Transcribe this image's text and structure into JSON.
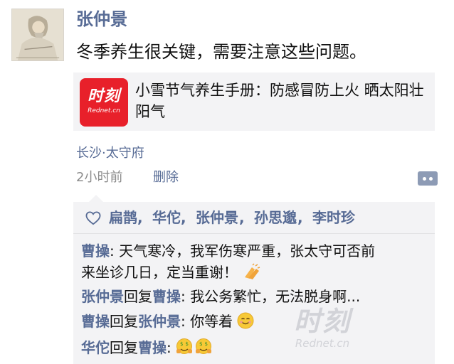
{
  "post": {
    "author": "张仲景",
    "text": "冬季养生很关键，需要注意这些问题。",
    "avatar_icon": "portrait-avatar",
    "link": {
      "logo_main": "时刻",
      "logo_sub": "Rednet.cn",
      "logo_color": "#e8202a",
      "title": "小雪节气养生手册：防感冒防上火 晒太阳壮阳气"
    },
    "location": "长沙·太守府",
    "time": "2小时前",
    "delete_label": "删除",
    "more_icon": "comment-menu-icon"
  },
  "likes": {
    "icon": "heart-outline-icon",
    "names": [
      "扁鹊",
      "华佗",
      "张仲景",
      "孙思邈",
      "李时珍"
    ],
    "separator": ","
  },
  "comments": [
    {
      "from": "曹操",
      "reply_word": "",
      "to": "",
      "colon": ": ",
      "text_line1": "天气寒冷，我军伤寒严重，张太守可否前",
      "text_line2": "来坐诊几日，定当重谢！",
      "emoji": "clapping-hands-emoji"
    },
    {
      "from": "张仲景",
      "reply_word": "回复",
      "to": "曹操",
      "colon": ": ",
      "text_line1": "我公务繁忙，无法脱身啊...",
      "emoji": ""
    },
    {
      "from": "曹操",
      "reply_word": "回复",
      "to": "张仲景",
      "colon": ": ",
      "text_line1": "你等着",
      "emoji": "smile-emoji"
    },
    {
      "from": "华佗",
      "reply_word": "回复",
      "to": "曹操",
      "colon": ": ",
      "text_line1": "",
      "emoji": "greedy-emoji-x2"
    }
  ],
  "watermark": {
    "main": "时刻",
    "sub": "Rednet.cn"
  },
  "colors": {
    "link_blue": "#576b95",
    "panel_bg": "#f3f3f5",
    "gray_text": "#8c8c8c"
  }
}
